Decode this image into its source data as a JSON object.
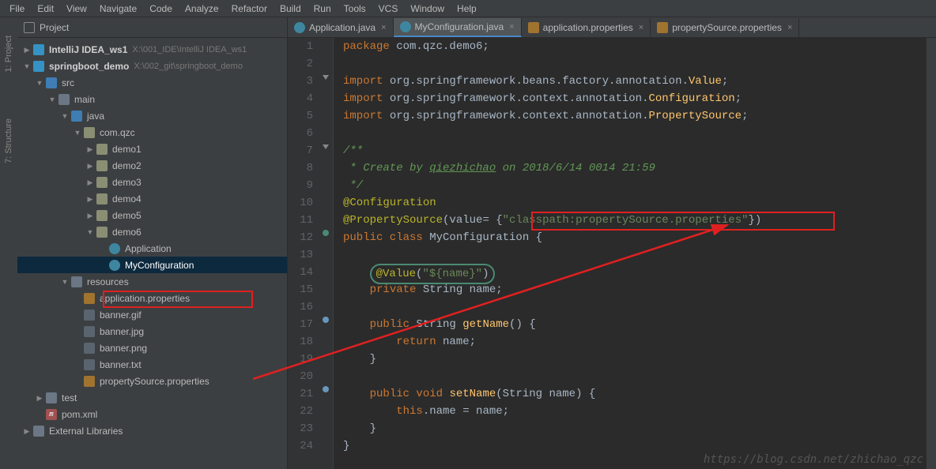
{
  "menu": [
    "File",
    "Edit",
    "View",
    "Navigate",
    "Code",
    "Analyze",
    "Refactor",
    "Build",
    "Run",
    "Tools",
    "VCS",
    "Window",
    "Help"
  ],
  "side_tabs": {
    "project": "1: Project",
    "structure": "7: Structure"
  },
  "project_header": {
    "label": "Project"
  },
  "tree": {
    "root1": {
      "name": "IntelliJ IDEA_ws1",
      "path": "X:\\001_IDE\\IntelliJ IDEA_ws1"
    },
    "root2": {
      "name": "springboot_demo",
      "path": "X:\\002_git\\springboot_demo"
    },
    "src": "src",
    "main": "main",
    "java": "java",
    "pkg": "com.qzc",
    "demos": [
      "demo1",
      "demo2",
      "demo3",
      "demo4",
      "demo5",
      "demo6"
    ],
    "demo6_files": [
      "Application",
      "MyConfiguration"
    ],
    "resources": "resources",
    "res_files": [
      "application.properties",
      "banner.gif",
      "banner.jpg",
      "banner.png",
      "banner.txt",
      "propertySource.properties"
    ],
    "test": "test",
    "pom": "pom.xml",
    "ext_lib": "External Libraries"
  },
  "tabs": [
    {
      "label": "Application.java",
      "icon": "java"
    },
    {
      "label": "MyConfiguration.java",
      "icon": "java",
      "active": true
    },
    {
      "label": "application.properties",
      "icon": "prop"
    },
    {
      "label": "propertySource.properties",
      "icon": "prop"
    }
  ],
  "code_lines": {
    "1": {
      "segments": [
        {
          "t": "package ",
          "c": "kw"
        },
        {
          "t": "com.qzc.demo6;",
          "c": "id"
        }
      ]
    },
    "2": {
      "segments": []
    },
    "3": {
      "segments": [
        {
          "t": "import ",
          "c": "kw"
        },
        {
          "t": "org.springframework.beans.factory.annotation.",
          "c": "id"
        },
        {
          "t": "Value",
          "c": "cls"
        },
        {
          "t": ";",
          "c": "id"
        }
      ]
    },
    "4": {
      "segments": [
        {
          "t": "import ",
          "c": "kw"
        },
        {
          "t": "org.springframework.context.annotation.",
          "c": "id"
        },
        {
          "t": "Configuration",
          "c": "cls"
        },
        {
          "t": ";",
          "c": "id"
        }
      ]
    },
    "5": {
      "segments": [
        {
          "t": "import ",
          "c": "kw"
        },
        {
          "t": "org.springframework.context.annotation.",
          "c": "id"
        },
        {
          "t": "PropertySource",
          "c": "cls"
        },
        {
          "t": ";",
          "c": "id"
        }
      ]
    },
    "6": {
      "segments": []
    },
    "7": {
      "segments": [
        {
          "t": "/**",
          "c": "com-doc"
        }
      ]
    },
    "8": {
      "segments": [
        {
          "t": " * Create by ",
          "c": "com-doc"
        },
        {
          "t": "qiezhichao",
          "c": "com-doc author"
        },
        {
          "t": " on 2018/6/14 0014 21:59",
          "c": "com-doc"
        }
      ]
    },
    "9": {
      "segments": [
        {
          "t": " */",
          "c": "com-doc"
        }
      ]
    },
    "10": {
      "segments": [
        {
          "t": "@Configuration",
          "c": "anno"
        }
      ]
    },
    "11": {
      "segments": [
        {
          "t": "@PropertySource",
          "c": "anno"
        },
        {
          "t": "(value= {",
          "c": "id"
        },
        {
          "t": "\"classpath:propertySource.properties\"",
          "c": "str"
        },
        {
          "t": "})",
          "c": "id"
        }
      ]
    },
    "12": {
      "segments": [
        {
          "t": "public class ",
          "c": "kw"
        },
        {
          "t": "MyConfiguration ",
          "c": "id"
        },
        {
          "t": "{",
          "c": "id"
        }
      ]
    },
    "13": {
      "segments": []
    },
    "14": {
      "segments": [
        {
          "t": "    ",
          "c": "id"
        },
        {
          "t": "@Value",
          "c": "anno",
          "circled": true
        },
        {
          "t": "(",
          "c": "id",
          "circled": true
        },
        {
          "t": "\"${name}\"",
          "c": "str",
          "circled": true
        },
        {
          "t": ")",
          "c": "id",
          "circled": true
        }
      ]
    },
    "15": {
      "segments": [
        {
          "t": "    ",
          "c": "id"
        },
        {
          "t": "private ",
          "c": "kw"
        },
        {
          "t": "String name;",
          "c": "id"
        }
      ]
    },
    "16": {
      "segments": []
    },
    "17": {
      "segments": [
        {
          "t": "    ",
          "c": "id"
        },
        {
          "t": "public ",
          "c": "kw"
        },
        {
          "t": "String ",
          "c": "id"
        },
        {
          "t": "getName",
          "c": "fn"
        },
        {
          "t": "() {",
          "c": "id"
        }
      ]
    },
    "18": {
      "segments": [
        {
          "t": "        ",
          "c": "id"
        },
        {
          "t": "return ",
          "c": "kw"
        },
        {
          "t": "name;",
          "c": "id"
        }
      ]
    },
    "19": {
      "segments": [
        {
          "t": "    }",
          "c": "id"
        }
      ]
    },
    "20": {
      "segments": []
    },
    "21": {
      "segments": [
        {
          "t": "    ",
          "c": "id"
        },
        {
          "t": "public void ",
          "c": "kw"
        },
        {
          "t": "setName",
          "c": "fn"
        },
        {
          "t": "(String name) {",
          "c": "id"
        }
      ]
    },
    "22": {
      "segments": [
        {
          "t": "        ",
          "c": "id"
        },
        {
          "t": "this",
          "c": "kw"
        },
        {
          "t": ".name = name;",
          "c": "id"
        }
      ]
    },
    "23": {
      "segments": [
        {
          "t": "    }",
          "c": "id"
        }
      ]
    },
    "24": {
      "segments": [
        {
          "t": "}",
          "c": "id"
        }
      ]
    }
  },
  "watermark": "https://blog.csdn.net/zhichao_qzc"
}
